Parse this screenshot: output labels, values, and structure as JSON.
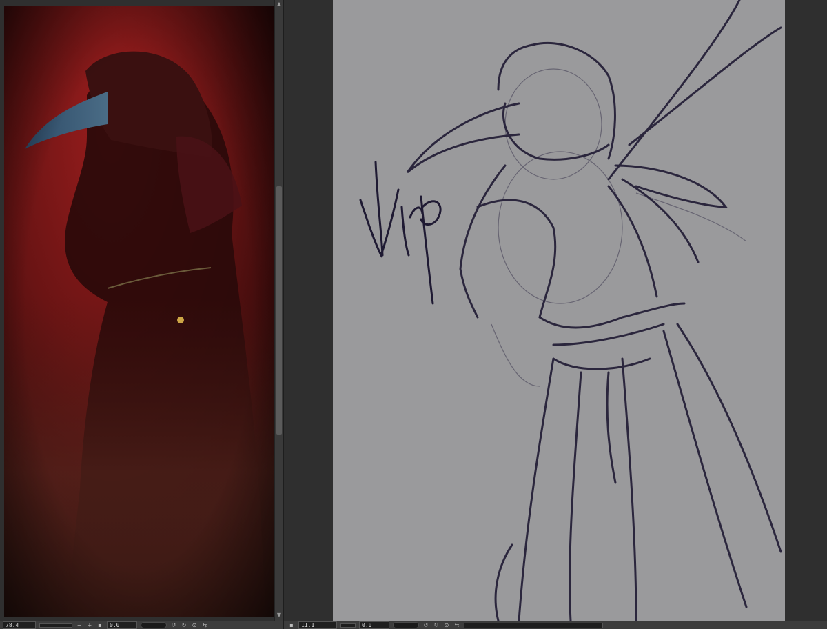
{
  "left_view": {
    "zoom_value": "78.4",
    "angle_value": "0.0",
    "artwork": "hooded-plague-doctor-painting-red"
  },
  "right_view": {
    "zoom_value": "11.1",
    "angle_value": "0.0",
    "artwork": "hooded-plague-doctor-sketch-gray",
    "signature_text": "Wip"
  },
  "icons": {
    "zoom_in": "+",
    "zoom_out": "−",
    "rotate_left": "↺",
    "rotate_right": "↻",
    "reset": "⊙",
    "flip": "⇆",
    "scroll_up": "▲",
    "scroll_down": "▼"
  },
  "colors": {
    "painting_background": "#6e1414",
    "sketch_background": "#9a9a9c",
    "sketch_line": "#1f1a33"
  }
}
